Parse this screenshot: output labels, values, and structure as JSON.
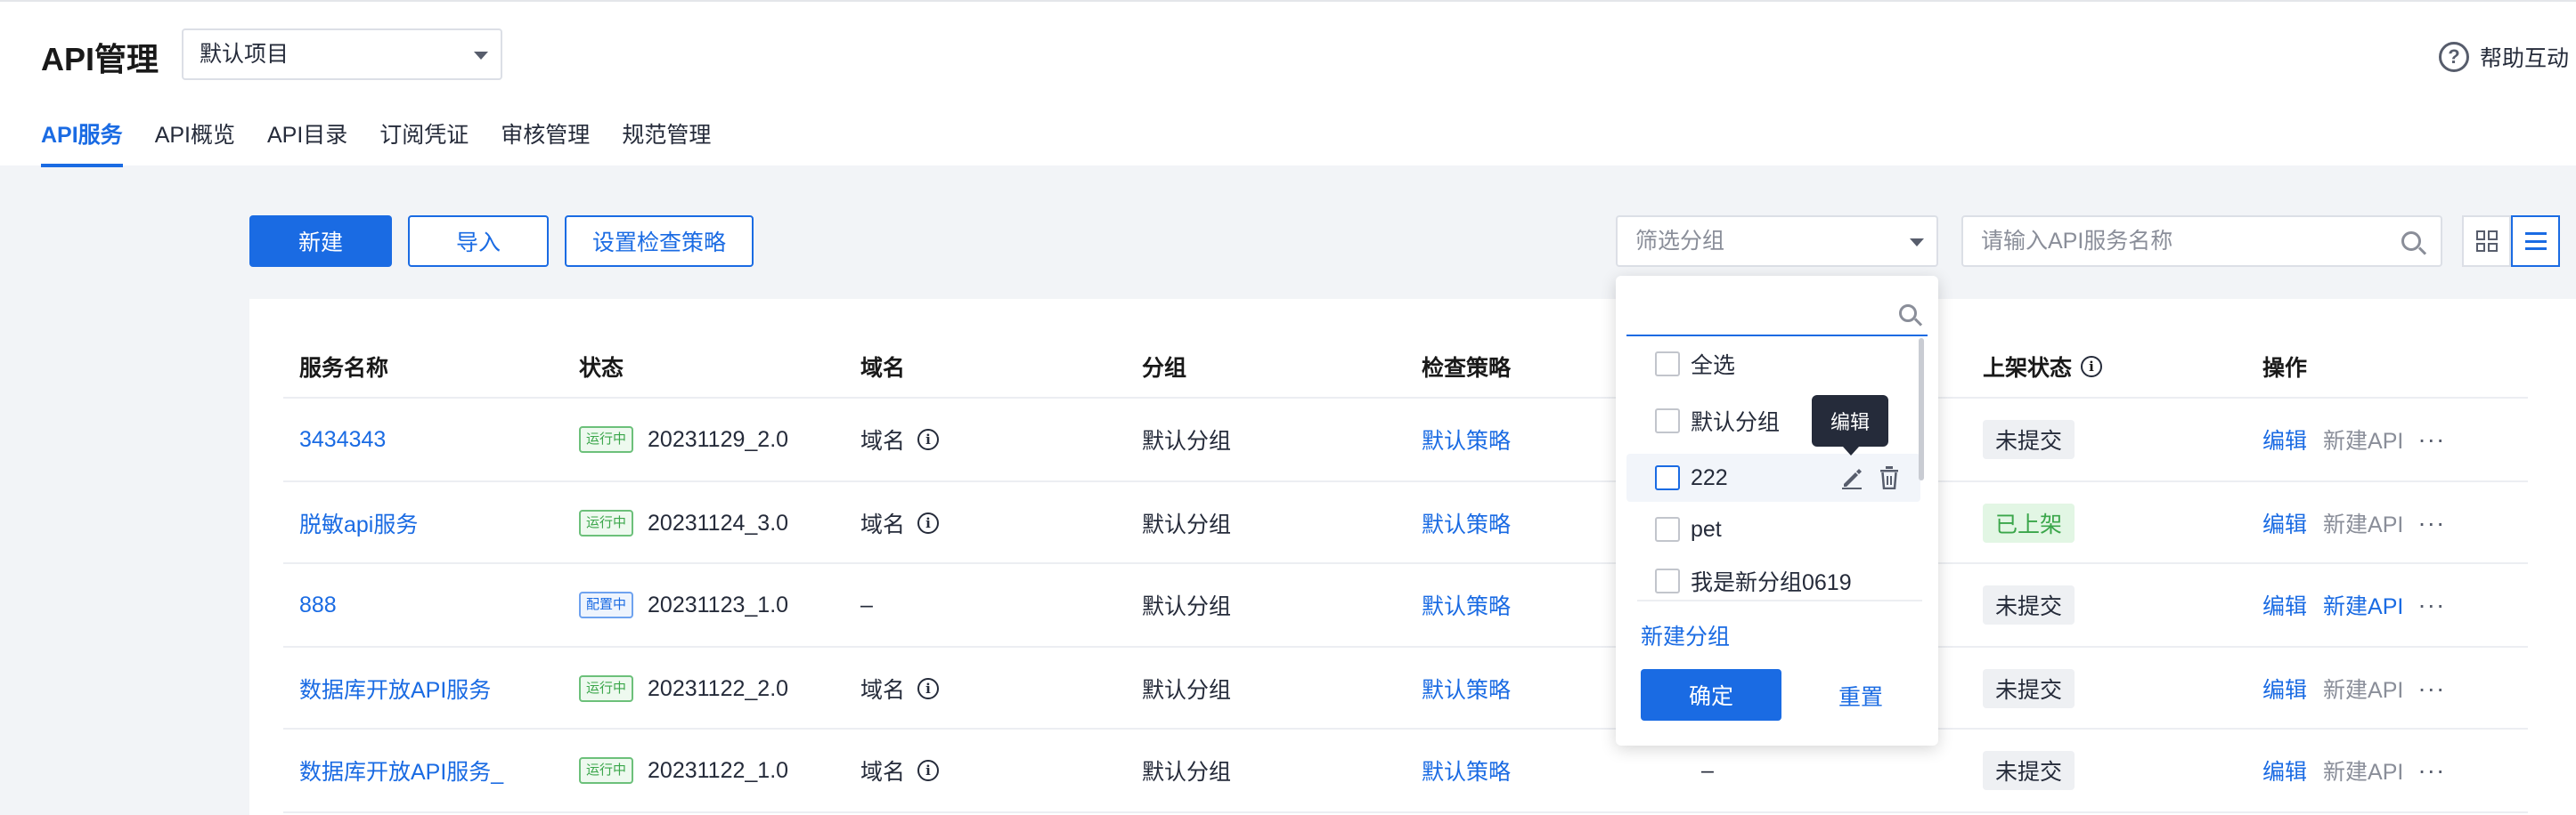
{
  "header": {
    "title": "API管理",
    "project": "默认项目",
    "help": "帮助互动"
  },
  "tabs": [
    "API服务",
    "API概览",
    "API目录",
    "订阅凭证",
    "审核管理",
    "规范管理"
  ],
  "toolbar": {
    "new": "新建",
    "import": "导入",
    "policy": "设置检查策略",
    "filter_placeholder": "筛选分组",
    "search_placeholder": "请输入API服务名称"
  },
  "columns": {
    "name": "服务名称",
    "status": "状态",
    "domain": "域名",
    "group": "分组",
    "policy": "检查策略",
    "publish": "上架状态",
    "actions": "操作"
  },
  "rows": [
    {
      "name": "3434343",
      "badge": "运行中",
      "badge_type": "running",
      "version": "20231129_2.0",
      "domain": "域名",
      "group": "默认分组",
      "policy": "默认策略",
      "col5": "",
      "publish": "未提交",
      "publish_type": "none",
      "edit": "编辑",
      "new_api": "新建API",
      "new_api_enabled": false
    },
    {
      "name": "脱敏api服务",
      "badge": "运行中",
      "badge_type": "running",
      "version": "20231124_3.0",
      "domain": "域名",
      "group": "默认分组",
      "policy": "默认策略",
      "col5": "",
      "publish": "已上架",
      "publish_type": "live",
      "edit": "编辑",
      "new_api": "新建API",
      "new_api_enabled": false
    },
    {
      "name": "888",
      "badge": "配置中",
      "badge_type": "config",
      "version": "20231123_1.0",
      "domain": "–",
      "group": "默认分组",
      "policy": "默认策略",
      "col5": "",
      "publish": "未提交",
      "publish_type": "none",
      "edit": "编辑",
      "new_api": "新建API",
      "new_api_enabled": true
    },
    {
      "name": "数据库开放API服务",
      "badge": "运行中",
      "badge_type": "running",
      "version": "20231122_2.0",
      "domain": "域名",
      "group": "默认分组",
      "policy": "默认策略",
      "col5": "",
      "publish": "未提交",
      "publish_type": "none",
      "edit": "编辑",
      "new_api": "新建API",
      "new_api_enabled": false
    },
    {
      "name": "数据库开放API服务_",
      "badge": "运行中",
      "badge_type": "running",
      "version": "20231122_1.0",
      "domain": "域名",
      "group": "默认分组",
      "policy": "默认策略",
      "col5": "–",
      "publish": "未提交",
      "publish_type": "none",
      "edit": "编辑",
      "new_api": "新建API",
      "new_api_enabled": false
    }
  ],
  "more_glyph": "···",
  "dropdown": {
    "search_value": "",
    "items": [
      "全选",
      "默认分组",
      "222",
      "pet",
      "我是新分组0619"
    ],
    "new_group": "新建分组",
    "confirm": "确定",
    "reset": "重置",
    "tooltip": "编辑"
  },
  "colors": {
    "accent": "#1a6be3",
    "running": "#3aa64a",
    "page_bg": "#f2f4f7"
  }
}
